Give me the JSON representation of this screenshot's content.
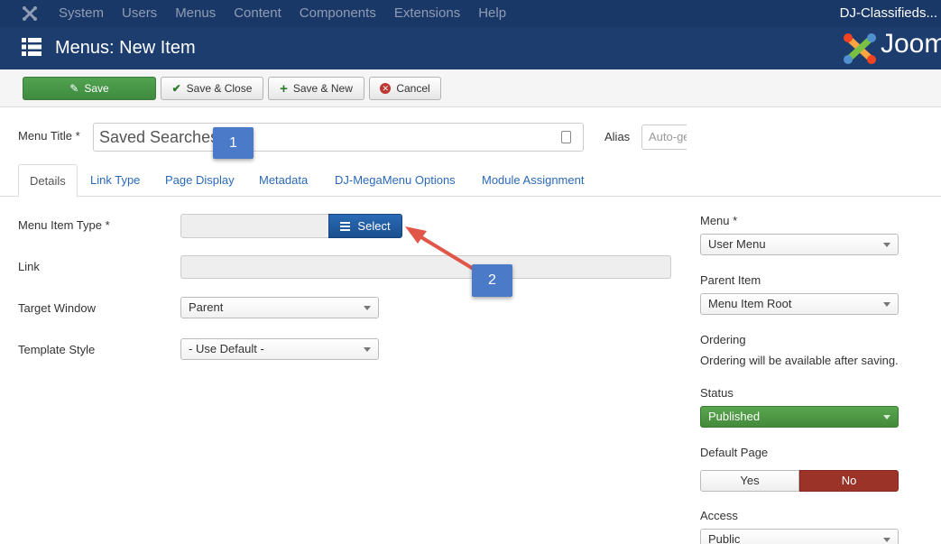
{
  "topnav": {
    "items": [
      "System",
      "Users",
      "Menus",
      "Content",
      "Components",
      "Extensions",
      "Help"
    ],
    "site_name": "DJ-Classifieds..."
  },
  "header": {
    "title": "Menus: New Item",
    "brand_text": "Joom"
  },
  "toolbar": {
    "save": "Save",
    "save_close": "Save & Close",
    "save_new": "Save & New",
    "cancel": "Cancel"
  },
  "title_row": {
    "menu_title_label": "Menu Title *",
    "menu_title_value": "Saved Searches",
    "alias_label": "Alias",
    "alias_placeholder": "Auto-generate from title"
  },
  "callouts": {
    "one": "1",
    "two": "2"
  },
  "tabs": [
    "Details",
    "Link Type",
    "Page Display",
    "Metadata",
    "DJ-MegaMenu Options",
    "Module Assignment"
  ],
  "form": {
    "menu_item_type_label": "Menu Item Type *",
    "select_button": "Select",
    "link_label": "Link",
    "target_window_label": "Target Window",
    "target_window_value": "Parent",
    "template_style_label": "Template Style",
    "template_style_value": "- Use Default -"
  },
  "sidebar": {
    "menu_label": "Menu *",
    "menu_value": "User Menu",
    "parent_item_label": "Parent Item",
    "parent_item_value": "Menu Item Root",
    "ordering_label": "Ordering",
    "ordering_note": "Ordering will be available after saving.",
    "status_label": "Status",
    "status_value": "Published",
    "default_page_label": "Default Page",
    "default_yes": "Yes",
    "default_no": "No",
    "access_label": "Access",
    "access_value": "Public"
  },
  "colors": {
    "topnav_bg": "#1a3867",
    "header_bg": "#1c3d6e",
    "save_green": "#46954a",
    "select_blue": "#1f5aa0",
    "no_red": "#9c3329",
    "callout_blue": "#4a7ac8",
    "arrow_red": "#e0574a"
  }
}
